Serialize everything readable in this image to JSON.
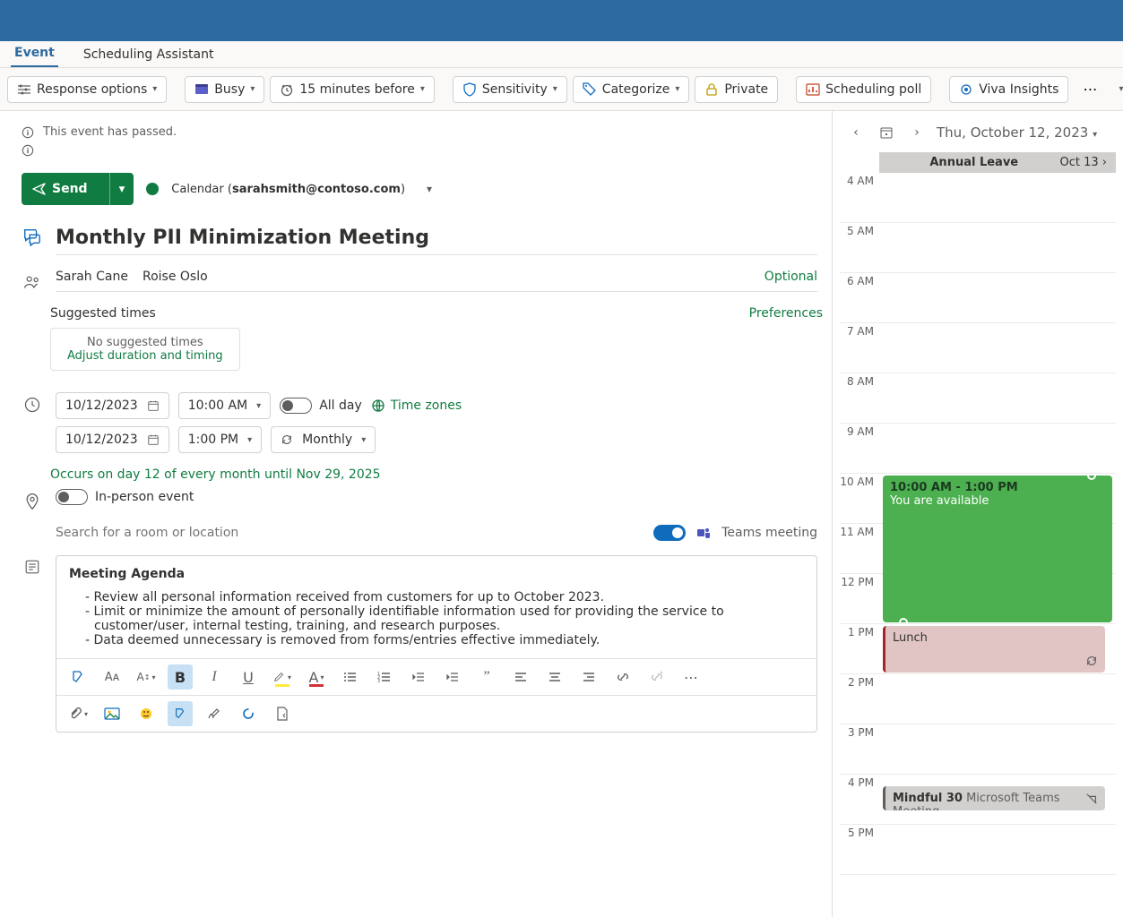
{
  "tabs": {
    "event": "Event",
    "sched": "Scheduling Assistant"
  },
  "ribbon": {
    "response": "Response options",
    "busy": "Busy",
    "reminder": "15 minutes before",
    "sensitivity": "Sensitivity",
    "categorize": "Categorize",
    "private": "Private",
    "poll": "Scheduling poll",
    "viva": "Viva Insights"
  },
  "info": {
    "passed": "This event has passed."
  },
  "send": "Send",
  "calendar": {
    "label": "Calendar (",
    "email": "sarahsmith@contoso.com",
    "close": ")"
  },
  "title": "Monthly PII Minimization Meeting",
  "attendees": {
    "a1": "Sarah Cane",
    "a2": "Roise Oslo",
    "optional": "Optional"
  },
  "suggested": {
    "label": "Suggested times",
    "prefs": "Preferences",
    "none": "No suggested times",
    "adjust": "Adjust duration and timing"
  },
  "dt": {
    "start_date": "10/12/2023",
    "start_time": "10:00 AM",
    "end_date": "10/12/2023",
    "end_time": "1:00 PM",
    "all_day": "All day",
    "time_zones": "Time zones",
    "repeat": "Monthly",
    "occurs": "Occurs on day 12 of every month until Nov 29, 2025"
  },
  "loc": {
    "inperson": "In-person event",
    "placeholder": "Search for a room or location",
    "teams": "Teams meeting"
  },
  "desc": {
    "heading": "Meeting Agenda",
    "l1": "- Review all personal information received from customers for up to October 2023.",
    "l2": "- Limit or minimize the amount of personally identifiable information used for providing the service to customer/user, internal testing, training, and research purposes.",
    "l3": "- Data deemed unnecessary is removed from forms/entries effective immediately."
  },
  "right": {
    "date": "Thu, October 12, 2023",
    "annual": "Annual Leave",
    "annual_date": "Oct 13",
    "hours": [
      "4 AM",
      "5 AM",
      "6 AM",
      "7 AM",
      "8 AM",
      "9 AM",
      "10 AM",
      "11 AM",
      "12 PM",
      "1 PM",
      "2 PM",
      "3 PM",
      "4 PM",
      "5 PM"
    ],
    "green_time": "10:00 AM - 1:00 PM",
    "green_sub": "You are available",
    "lunch": "Lunch",
    "mindful": "Mindful 30",
    "mindful_loc": "Microsoft Teams Meeting"
  }
}
